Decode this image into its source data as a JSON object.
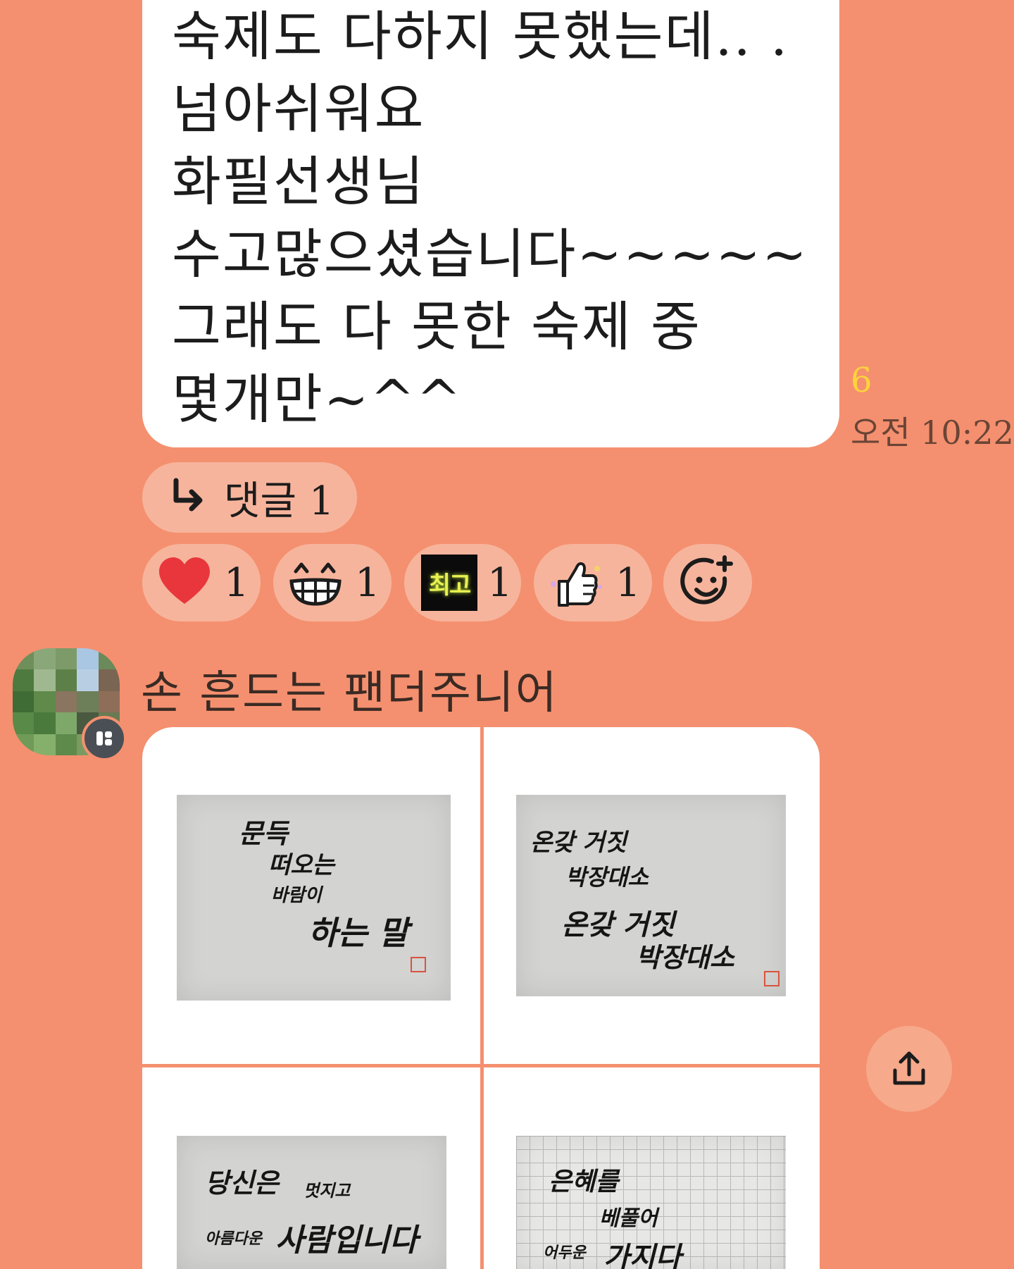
{
  "message": {
    "lines": [
      "숙제도 다하지 못했는데.. .",
      "넘아쉬워요",
      "화필선생님",
      "수고많으셨습니다~~~~~",
      "그래도 다 못한 숙제 중",
      "몇개만~^^"
    ],
    "unread_count": "6",
    "time": "오전 10:22"
  },
  "reply": {
    "icon": "reply-arrow-icon",
    "label": "댓글 1"
  },
  "reactions": [
    {
      "icon": "heart-icon",
      "count": "1"
    },
    {
      "icon": "grin-face-icon",
      "count": "1"
    },
    {
      "icon": "best-sticker-icon",
      "label": "최고",
      "count": "1"
    },
    {
      "icon": "thumbs-up-icon",
      "count": "1"
    }
  ],
  "add_reaction": {
    "icon": "add-emoji-icon"
  },
  "sender": {
    "name": "손 흔드는 팬더주니어",
    "badge_icon": "profile-badge-icon"
  },
  "photos": [
    {
      "lines": [
        "문득",
        "떠오는",
        "바람이",
        "하는 말"
      ]
    },
    {
      "lines": [
        "온갖 거짓",
        "박장대소",
        "온갖 거짓",
        "박장대소"
      ]
    },
    {
      "lines": [
        "당신은",
        "멋지고",
        "아름다운",
        "사람입니다"
      ]
    },
    {
      "lines": [
        "은혜를",
        "베풀어",
        "어두운",
        "가지다"
      ]
    }
  ],
  "share_button": {
    "icon": "share-upload-icon"
  },
  "colors": {
    "background": "#f4906f",
    "bubble": "#ffffff",
    "pill": "#f7b49c",
    "unread": "#ffd43b",
    "heart": "#e8363c"
  }
}
